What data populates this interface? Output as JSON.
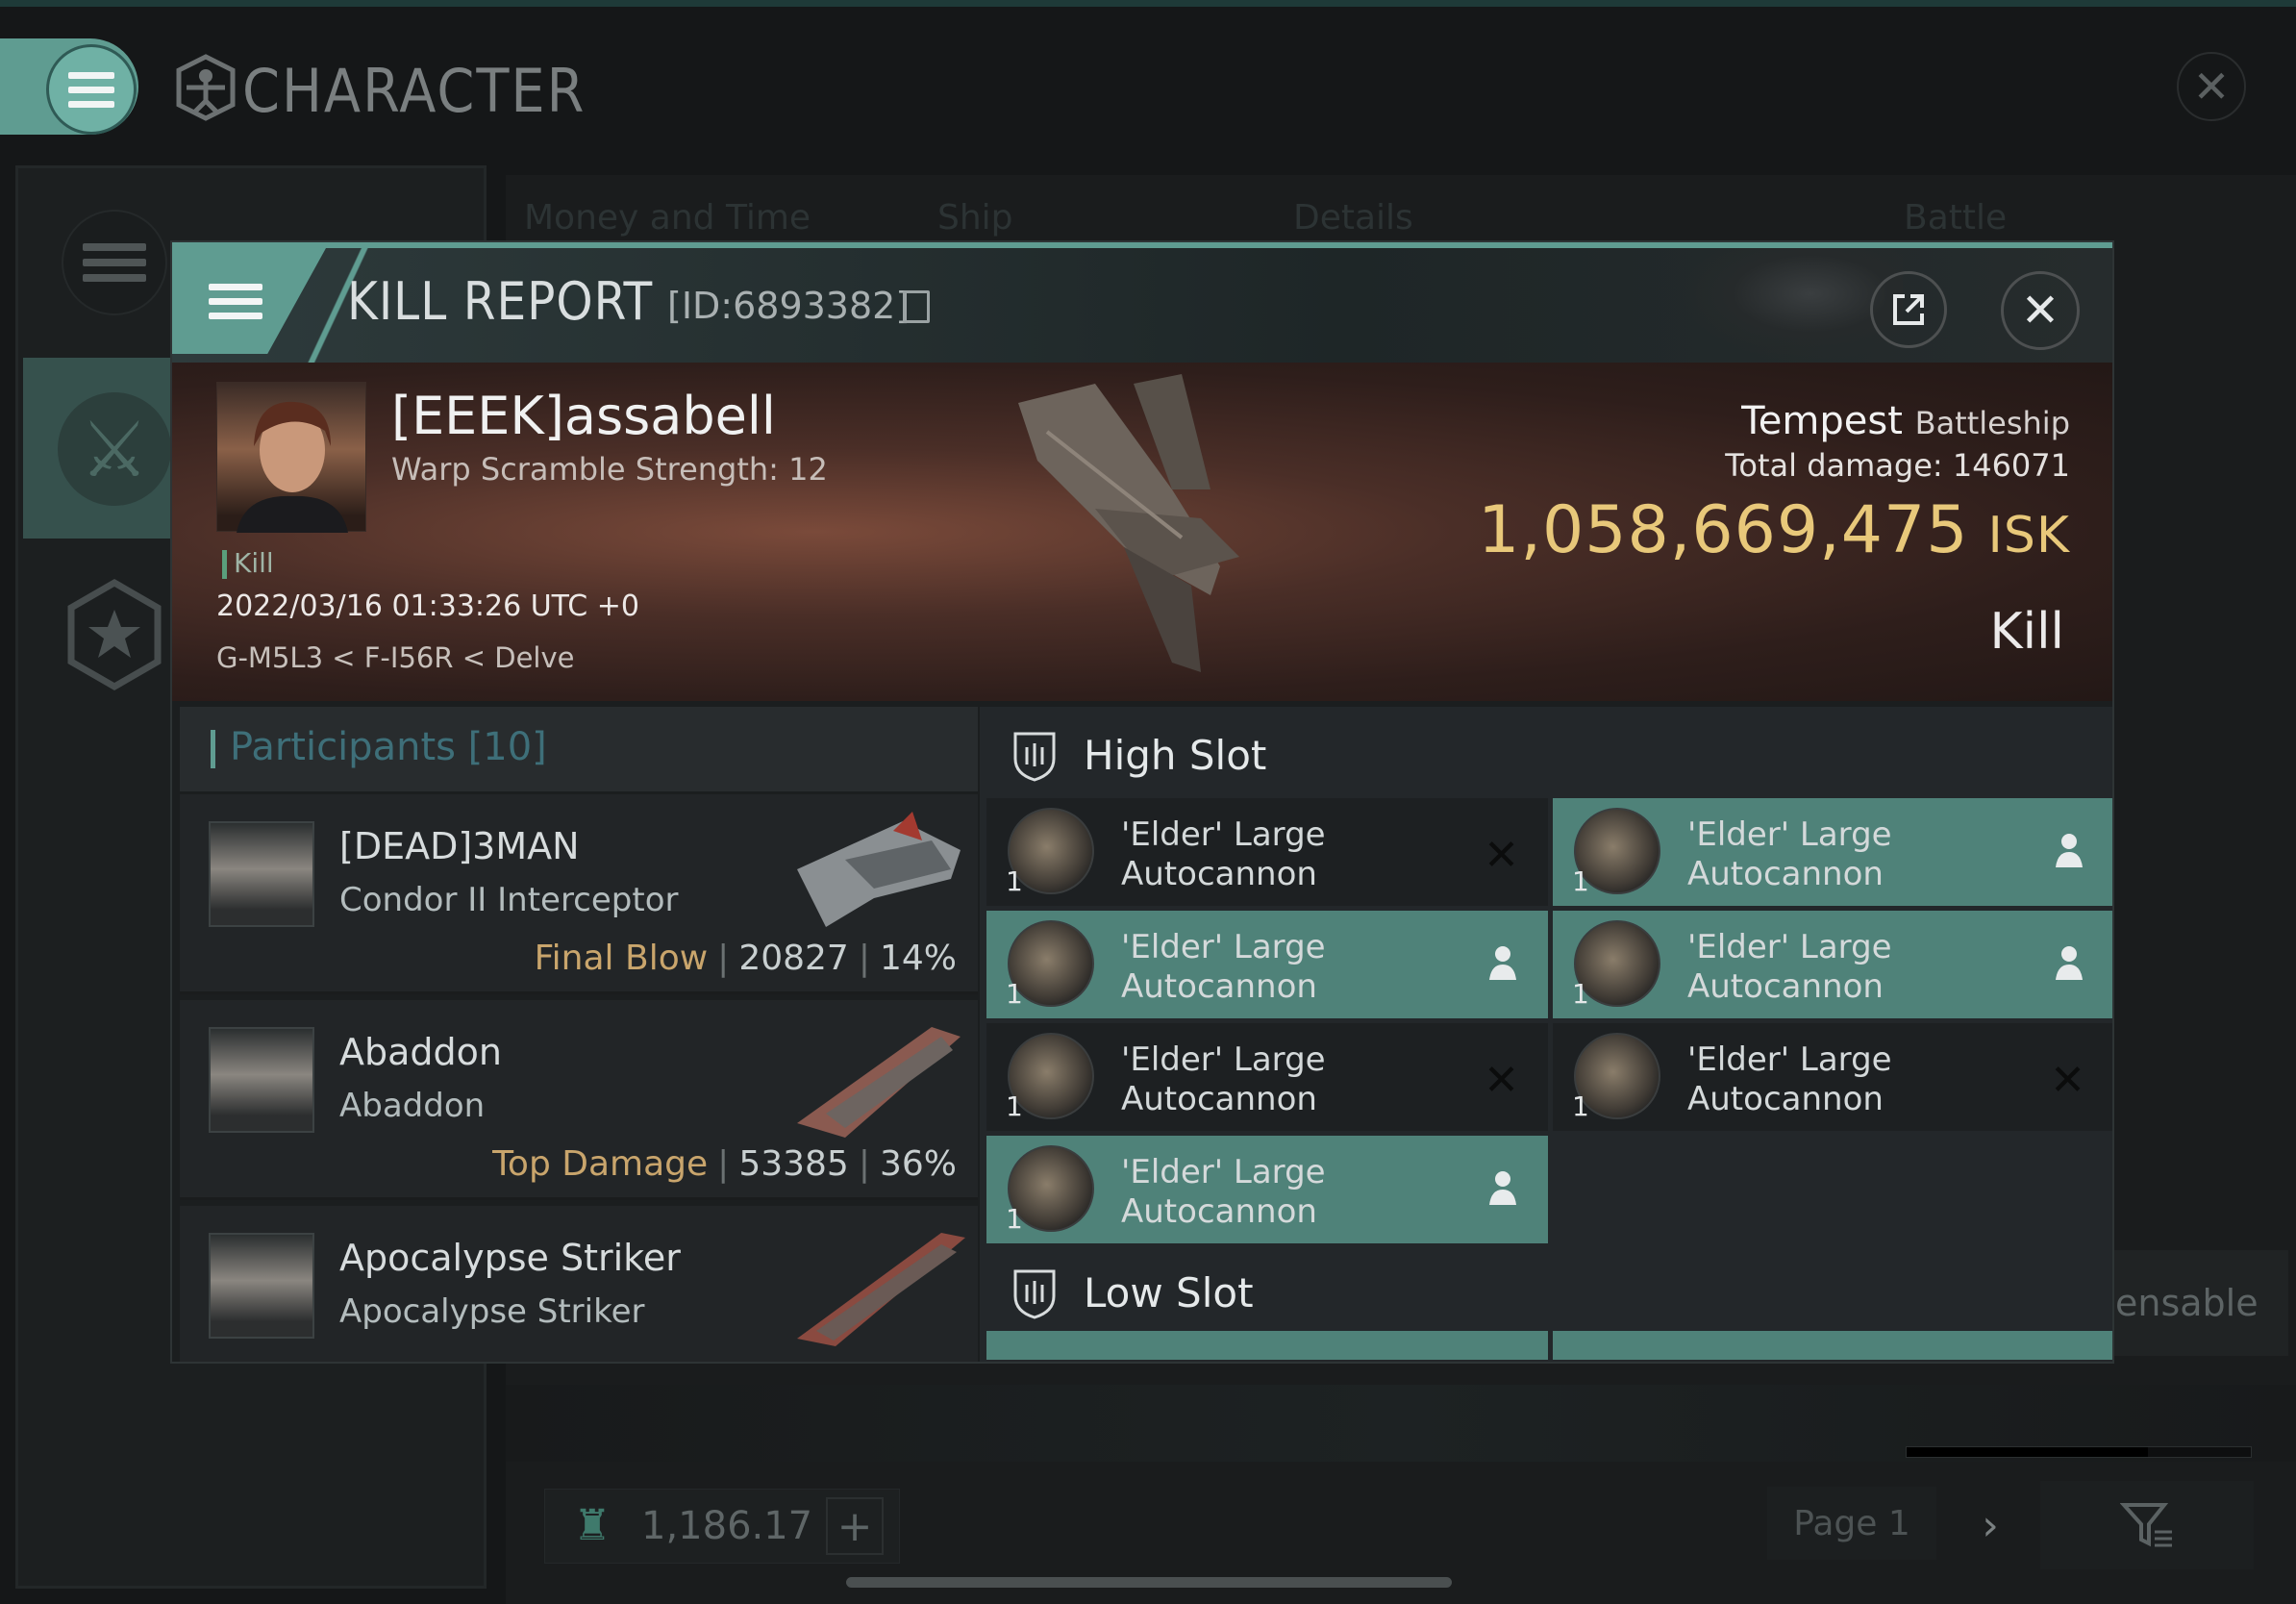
{
  "character_window": {
    "title": "CHARACTER",
    "background_tabs": [
      "Money and Time",
      "Ship",
      "Details",
      "Battle Status"
    ],
    "partial_button_text": "ensable",
    "wallet_amount": "1,186.17",
    "page_label": "Page 1"
  },
  "kill_report": {
    "title": "KILL REPORT",
    "id": "[ID:6893382]",
    "victim": {
      "name": "[EEEK]assabell",
      "warp_scramble": "Warp Scramble Strength: 12",
      "tag": "Kill",
      "timestamp": "2022/03/16 01:33:26 UTC +0",
      "location": "G-M5L3 < F-I56R < Delve",
      "ship_name": "Tempest",
      "ship_class": "Battleship",
      "total_damage_label": "Total damage:",
      "total_damage": "146071",
      "isk_value": "1,058,669,475",
      "isk_unit": "ISK",
      "result": "Kill"
    },
    "participants": {
      "title": "Participants [10]",
      "rows": [
        {
          "name": "[DEAD]3MAN",
          "ship": "Condor II Interceptor",
          "label": "Final Blow",
          "damage": "20827",
          "percent": "14%"
        },
        {
          "name": "Abaddon",
          "ship": "Abaddon",
          "label": "Top Damage",
          "damage": "53385",
          "percent": "36%"
        },
        {
          "name": "Apocalypse Striker",
          "ship": "Apocalypse Striker",
          "label": "",
          "damage": "",
          "percent": ""
        }
      ]
    },
    "high_slot": {
      "title": "High Slot",
      "items": [
        {
          "name_line1": "'Elder' Large",
          "name_line2": "Autocannon",
          "qty": "1",
          "status": "destroyed"
        },
        {
          "name_line1": "'Elder' Large",
          "name_line2": "Autocannon",
          "qty": "1",
          "status": "dropped"
        },
        {
          "name_line1": "'Elder' Large",
          "name_line2": "Autocannon",
          "qty": "1",
          "status": "dropped"
        },
        {
          "name_line1": "'Elder' Large",
          "name_line2": "Autocannon",
          "qty": "1",
          "status": "dropped"
        },
        {
          "name_line1": "'Elder' Large",
          "name_line2": "Autocannon",
          "qty": "1",
          "status": "destroyed"
        },
        {
          "name_line1": "'Elder' Large",
          "name_line2": "Autocannon",
          "qty": "1",
          "status": "destroyed"
        },
        {
          "name_line1": "'Elder' Large",
          "name_line2": "Autocannon",
          "qty": "1",
          "status": "dropped"
        }
      ]
    },
    "low_slot": {
      "title": "Low Slot"
    }
  },
  "icons": {
    "menu": "hamburger-icon",
    "external": "external-link-icon",
    "close": "close-icon",
    "destroyed": "x-mark",
    "dropped": "person-icon",
    "slot": "shield-slot-icon"
  },
  "colors": {
    "accent": "#5f9c91",
    "isk": "#e8c87a",
    "final_blow": "#c9a56c",
    "fitted_row": "#4f8279"
  }
}
